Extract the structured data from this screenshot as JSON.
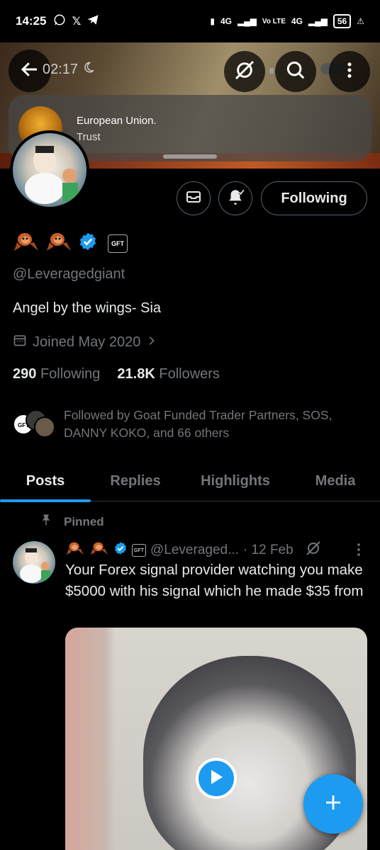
{
  "status_bar": {
    "time": "14:25",
    "net1": "4G",
    "net2": "Vo LTE",
    "net3": "4G",
    "battery": "56"
  },
  "header": {
    "video_time": "02:17"
  },
  "pip": {
    "title": "European Union.",
    "subtitle": "Trust"
  },
  "profile": {
    "handle": "@Leveragedgiant",
    "bio": "Angel by the wings- Sia",
    "joined": "Joined May 2020",
    "following_count": "290",
    "following_label": "Following",
    "followers_count": "21.8K",
    "followers_label": "Followers",
    "followed_by": "Followed by Goat Funded Trader Partners, SOS, DANNY KOKO, and 66 others",
    "follow_button": "Following",
    "affiliate_badge": "GFT"
  },
  "tabs": [
    {
      "label": "Posts"
    },
    {
      "label": "Replies"
    },
    {
      "label": "Highlights"
    },
    {
      "label": "Media"
    }
  ],
  "pinned_post": {
    "pinned_label": "Pinned",
    "handle": "@Leveraged...",
    "date": "· 12 Feb",
    "text": "Your Forex signal provider watching you make $5000 with his signal which he made $35 from"
  },
  "colors": {
    "accent": "#1d9bf0",
    "muted": "#71767b",
    "border": "#2f3336"
  },
  "icons": [
    "back-arrow-icon",
    "moon-icon",
    "grok-icon",
    "search-icon",
    "more-vertical-icon",
    "message-icon",
    "notification-bell-icon",
    "verified-badge-icon",
    "calendar-icon",
    "chevron-right-icon",
    "pin-icon",
    "play-icon",
    "plus-icon"
  ]
}
